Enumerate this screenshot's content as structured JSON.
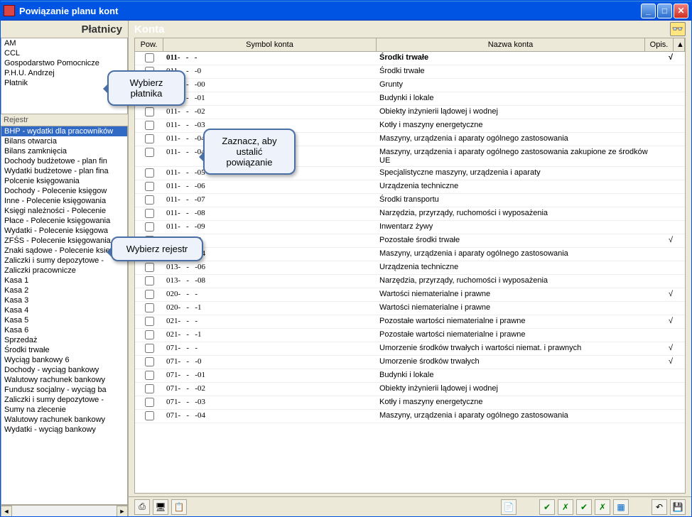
{
  "window": {
    "title": "Powiązanie planu kont"
  },
  "left": {
    "payers_header": "Płatnicy",
    "payers": [
      "AM",
      "CCL",
      "Gospodarstwo Pomocnicze",
      "P.H.U. Andrzej",
      "Płatnik"
    ],
    "registers_header": "Rejestr",
    "registers": [
      "BHP - wydatki dla pracowników",
      "Bilans otwarcia",
      "Bilans zamknięcia",
      "Dochody budżetowe - plan fin",
      "Wydatki budżetowe - plan fina",
      "Polcenie księgowania",
      "Dochody - Polecenie księgow",
      "Inne - Polecenie księgowania",
      "Księgi należności - Polecenie",
      "Płace - Polecenie księgowania",
      "Wydatki - Polecenie księgowa",
      "ZFŚS - Polecenie księgowania",
      "Znaki sądowe - Polecenie ksie",
      "Zaliczki i sumy depozytowe -",
      "Zaliczki pracownicze",
      "Kasa 1",
      "Kasa 2",
      "Kasa 3",
      "Kasa 4",
      "Kasa 5",
      "Kasa 6",
      "Sprzedaż",
      "Środki trwałe",
      "Wyciąg bankowy 6",
      "Dochody - wyciąg bankowy",
      "Walutowy rachunek bankowy",
      "Fundusz socjalny - wyciąg ba",
      "Zaliczki i sumy depozytowe -",
      "Sumy na zlecenie",
      "Walutowy rachunek bankowy",
      "Wydatki - wyciąg bankowy"
    ],
    "selected_register_index": 0
  },
  "right": {
    "header": "Konta",
    "columns": {
      "pow": "Pow.",
      "symbol": "Symbol konta",
      "name": "Nazwa konta",
      "opis": "Opis."
    },
    "rows": [
      {
        "sym": "011-   -   -",
        "name": "Środki trwałe",
        "opis": "√",
        "bold": true
      },
      {
        "sym": "011-   -   -0",
        "name": "Środki trwałe",
        "opis": ""
      },
      {
        "sym": "011-   -   -00",
        "name": "Grunty",
        "opis": ""
      },
      {
        "sym": "011-   -   -01",
        "name": "Budynki i lokale",
        "opis": ""
      },
      {
        "sym": "011-   -   -02",
        "name": "Obiekty inżynierii lądowej i wodnej",
        "opis": ""
      },
      {
        "sym": "011-   -   -03",
        "name": "Kotły i maszyny energetyczne",
        "opis": ""
      },
      {
        "sym": "011-   -   -04",
        "name": "Maszyny, urządzenia i aparaty ogólnego zastosowania",
        "opis": ""
      },
      {
        "sym": "011-   -   -041",
        "name": "Maszyny, urządzenia i aparaty ogólnego zastosowania zakupione ze środków UE",
        "opis": ""
      },
      {
        "sym": "011-   -   -05",
        "name": "Specjalistyczne maszyny, urządzenia i aparaty",
        "opis": ""
      },
      {
        "sym": "011-   -   -06",
        "name": "Urządzenia techniczne",
        "opis": ""
      },
      {
        "sym": "011-   -   -07",
        "name": "Środki transportu",
        "opis": ""
      },
      {
        "sym": "011-   -   -08",
        "name": "Narzędzia, przyrządy, ruchomości i wyposażenia",
        "opis": ""
      },
      {
        "sym": "011-   -   -09",
        "name": "Inwentarz żywy",
        "opis": ""
      },
      {
        "sym": "013-   -   -0",
        "name": "Pozostałe środki trwałe",
        "opis": "√"
      },
      {
        "sym": "013-   -   -04",
        "name": "Maszyny, urządzenia i aparaty ogólnego zastosowania",
        "opis": ""
      },
      {
        "sym": "013-   -   -06",
        "name": "Urządzenia techniczne",
        "opis": ""
      },
      {
        "sym": "013-   -   -08",
        "name": "Narzędzia, przyrządy, ruchomości i wyposażenia",
        "opis": ""
      },
      {
        "sym": "020-   -   -",
        "name": "Wartości niematerialne i prawne",
        "opis": "√"
      },
      {
        "sym": "020-   -   -1",
        "name": "Wartości niematerialne i prawne",
        "opis": ""
      },
      {
        "sym": "021-   -   -",
        "name": "Pozostałe wartości niematerialne i prawne",
        "opis": "√"
      },
      {
        "sym": "021-   -   -1",
        "name": "Pozostałe wartości niematerialne i prawne",
        "opis": ""
      },
      {
        "sym": "071-   -   -",
        "name": "Umorzenie środków trwałych i wartości niemat. i prawnych",
        "opis": "√"
      },
      {
        "sym": "071-   -   -0",
        "name": "Umorzenie środków trwałych",
        "opis": "√"
      },
      {
        "sym": "071-   -   -01",
        "name": "Budynki i lokale",
        "opis": ""
      },
      {
        "sym": "071-   -   -02",
        "name": "Obiekty inżynierii lądowej i wodnej",
        "opis": ""
      },
      {
        "sym": "071-   -   -03",
        "name": "Kotły i maszyny energetyczne",
        "opis": ""
      },
      {
        "sym": "071-   -   -04",
        "name": "Maszyny, urządzenia i aparaty ogólnego zastosowania",
        "opis": ""
      }
    ]
  },
  "callouts": {
    "c1": "Wybierz płatnika",
    "c2": "Zaznacz, aby ustalić powiązanie",
    "c3": "Wybierz rejestr"
  },
  "toolbar": {
    "print": "⎙",
    "screen": "🖥",
    "export": "📋",
    "doc": "📄",
    "check1": "✔",
    "check1x": "✗",
    "check2": "✔",
    "check2x": "✗",
    "grid": "▦",
    "undo": "↶",
    "save": "💾"
  }
}
